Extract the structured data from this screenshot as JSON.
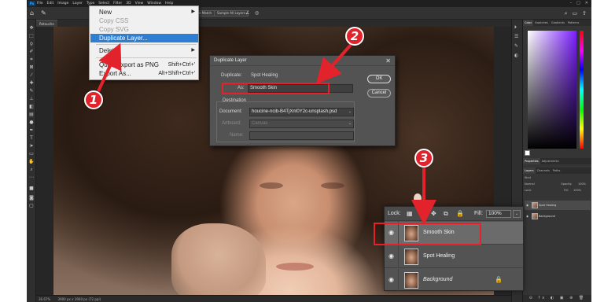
{
  "app": {
    "logo": "Ps",
    "menus": [
      "File",
      "Edit",
      "Image",
      "Layer",
      "Type",
      "Select",
      "Filter",
      "3D",
      "View",
      "Window",
      "Help"
    ],
    "window_controls": [
      "–",
      "□",
      "✕"
    ]
  },
  "options_bar": {
    "icons": [
      "home-icon",
      "brush-tool-icon"
    ],
    "sample_label": "Sample All Layers",
    "content_aware_label": "Content-Aware Match",
    "right_icons": [
      "search-icon",
      "workspace-icon",
      "share-icon"
    ]
  },
  "document_tab": {
    "label": "Retouche"
  },
  "status_bar": {
    "zoom": "36.67%",
    "size": "3900 px x 3900 px (72 ppi)"
  },
  "edit_menu": {
    "items": [
      {
        "label": "New",
        "shortcut": "",
        "submenu": true,
        "disabled": false
      },
      {
        "label": "Copy CSS",
        "shortcut": "",
        "submenu": false,
        "disabled": true
      },
      {
        "label": "Copy SVG",
        "shortcut": "",
        "submenu": false,
        "disabled": true
      },
      {
        "label": "Duplicate Layer...",
        "shortcut": "",
        "submenu": false,
        "disabled": false,
        "highlighted": true
      },
      {
        "label": "Delete",
        "shortcut": "",
        "submenu": true,
        "disabled": false
      },
      {
        "label": "Quick Export as PNG",
        "shortcut": "Shift+Ctrl+'",
        "submenu": false,
        "disabled": false
      },
      {
        "label": "Export As...",
        "shortcut": "Alt+Shift+Ctrl+'",
        "submenu": false,
        "disabled": false
      }
    ]
  },
  "dialog": {
    "title": "Duplicate Layer",
    "close": "✕",
    "duplicate_label": "Duplicate:",
    "duplicate_value": "Spot Healing",
    "as_label": "As:",
    "as_value": "Smooth Skin",
    "destination_label": "Destination",
    "document_label": "Document:",
    "document_value": "houcine-ncib-B4TjXnI0Y2c-unsplash.psd",
    "artboard_label": "Artboard:",
    "artboard_value": "Canvas",
    "name_label": "Name:",
    "name_value": "",
    "ok_label": "OK",
    "cancel_label": "Cancel"
  },
  "layers_panel": {
    "lock_label": "Lock:",
    "fill_label": "Fill:",
    "fill_value": "100%",
    "layers": [
      {
        "name": "Smooth Skin",
        "selected": true,
        "locked": false,
        "italic": false
      },
      {
        "name": "Spot Healing",
        "selected": false,
        "locked": false,
        "italic": false
      },
      {
        "name": "Background",
        "selected": false,
        "locked": true,
        "italic": true
      }
    ]
  },
  "right_panel": {
    "top_tabs": [
      "Color",
      "Swatches",
      "Gradients",
      "Patterns"
    ],
    "mid_tabs": [
      "Properties",
      "Adjustments"
    ],
    "layer_tabs": [
      "Layers",
      "Channels",
      "Paths"
    ],
    "kind_label": "Kind",
    "blend_mode": "Normal",
    "opacity_label": "Opacity:",
    "opacity_value": "100%",
    "lock_label": "Lock:",
    "fill_label": "Fill:",
    "fill_value": "100%",
    "mini_layers": [
      "Spot Healing",
      "Background"
    ]
  },
  "annotations": {
    "callouts": [
      "1",
      "2",
      "3"
    ],
    "accent": "#e3232c"
  }
}
